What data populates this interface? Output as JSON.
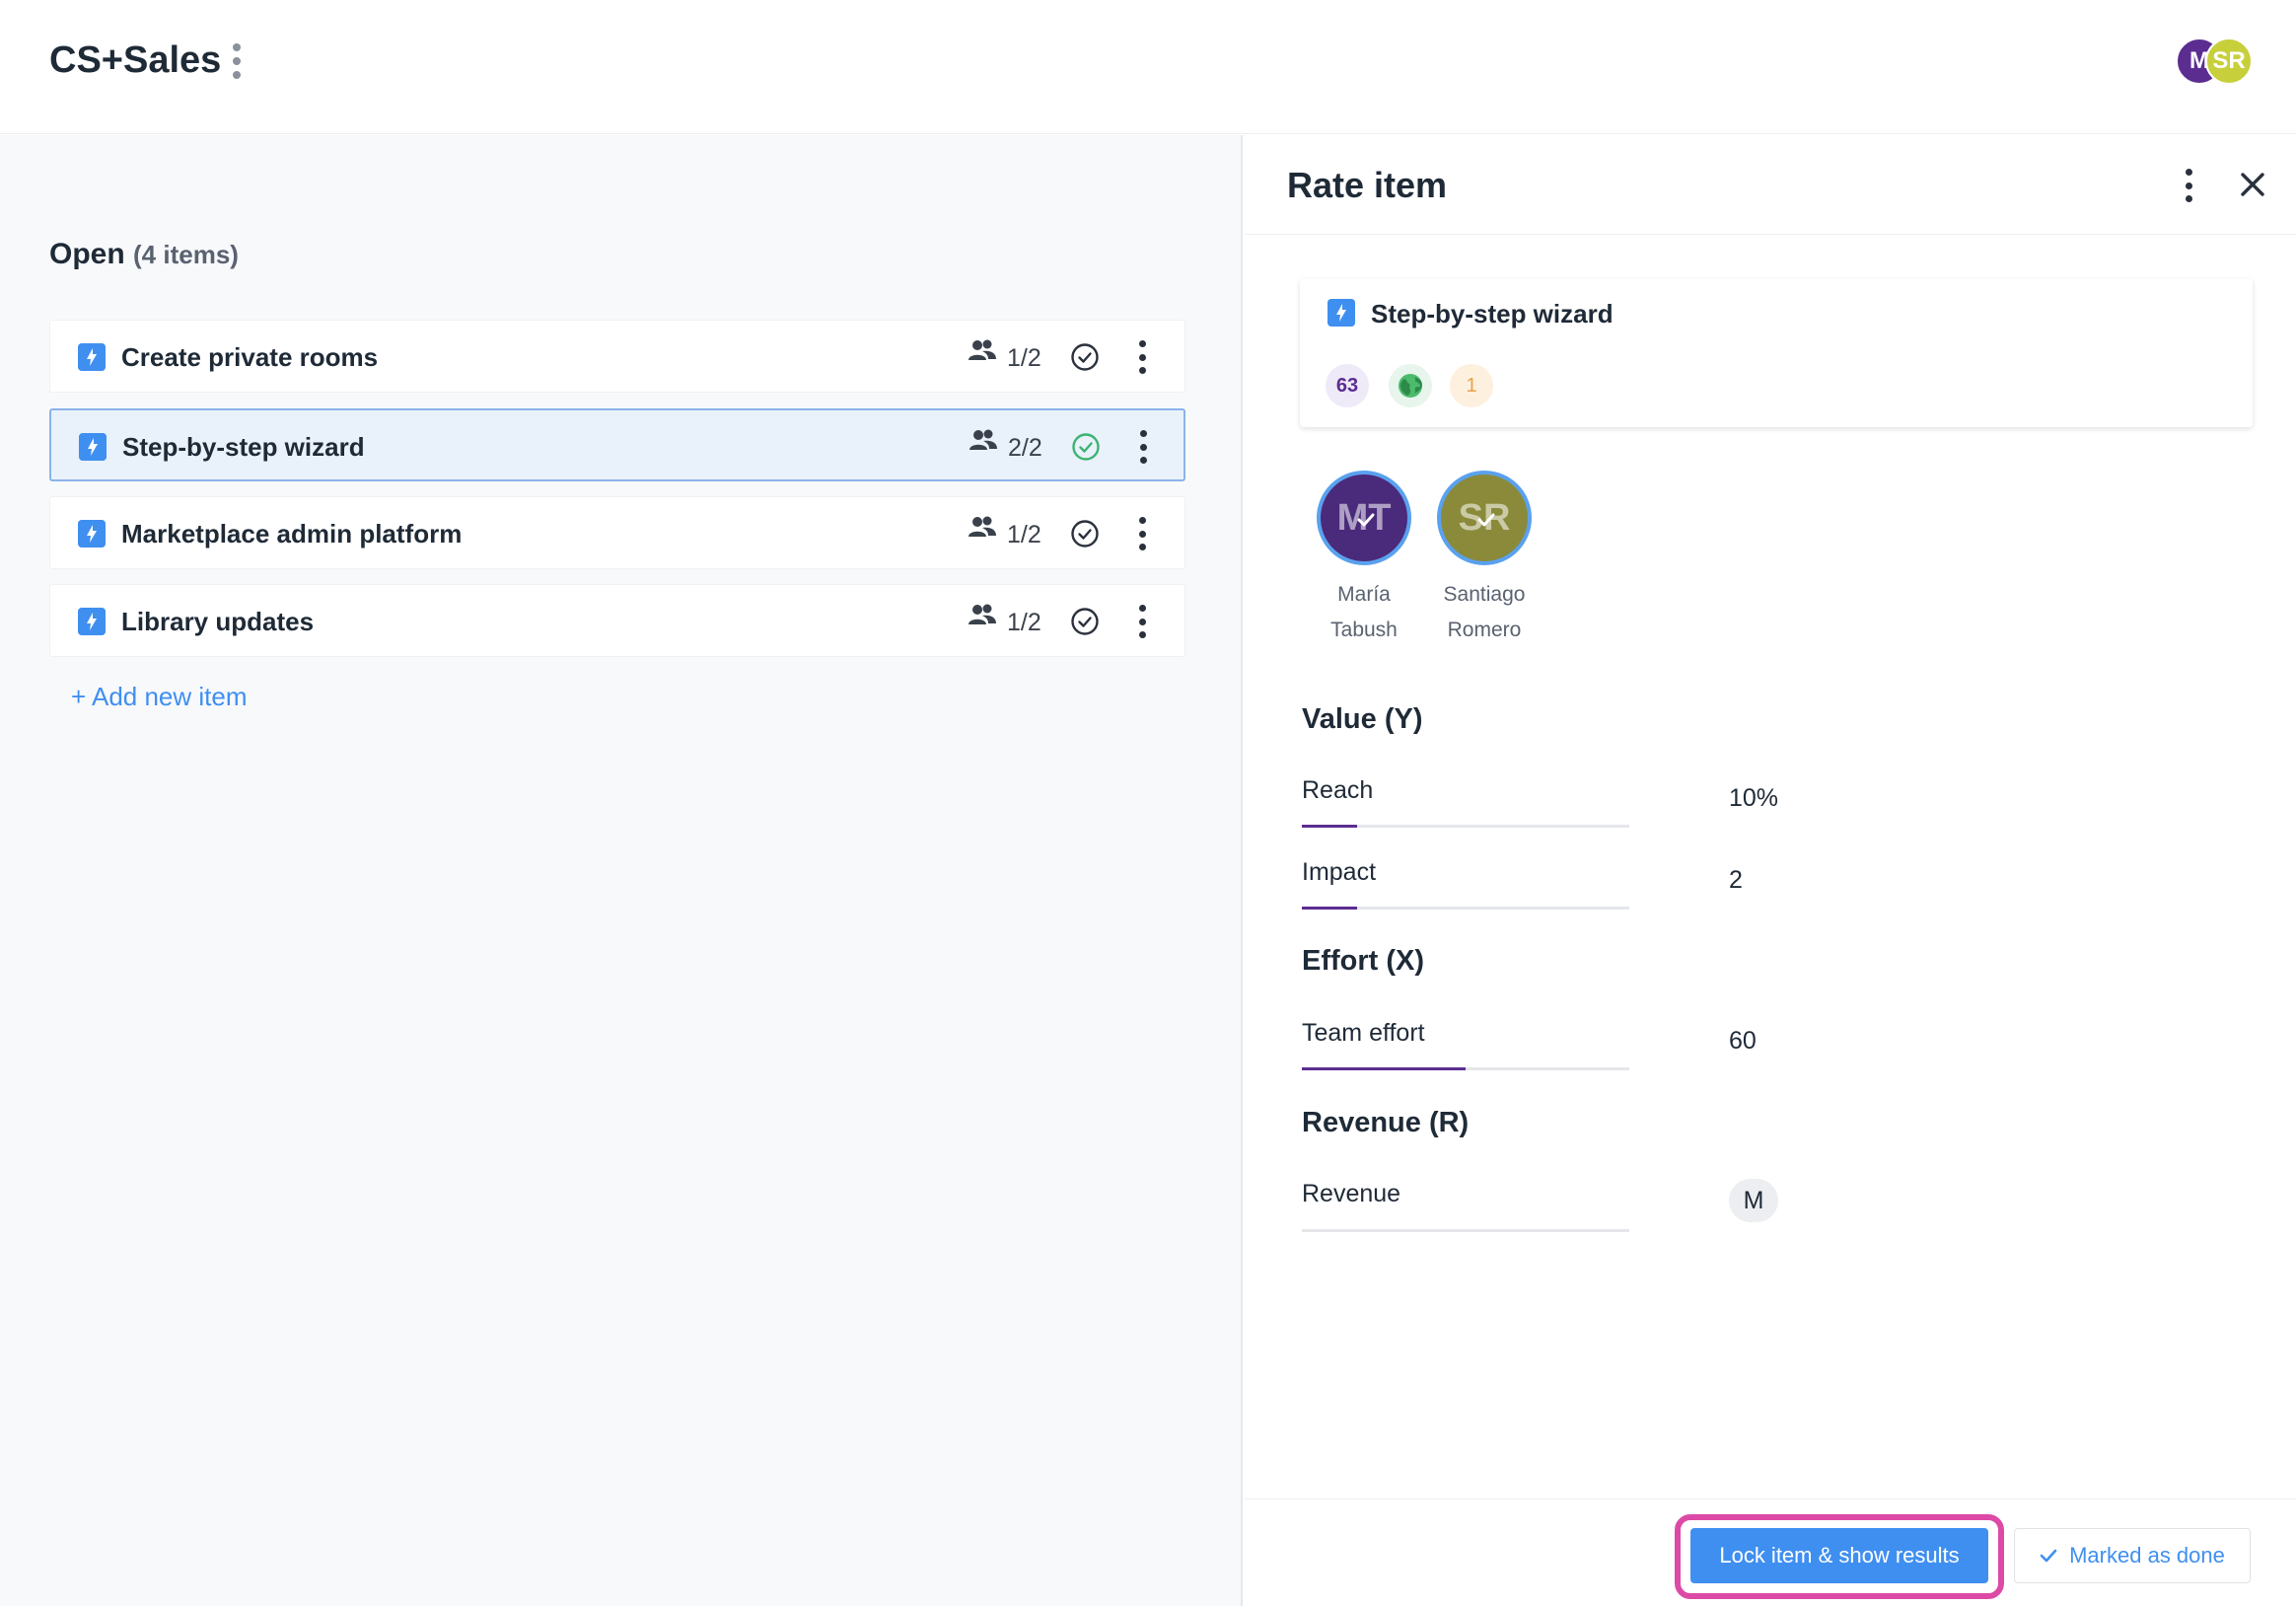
{
  "header": {
    "title": "CS+Sales",
    "avatars": [
      "M",
      "SR"
    ]
  },
  "list": {
    "section_title": "Open",
    "section_count": "(4 items)",
    "items": [
      {
        "title": "Create private rooms",
        "raters": "1/2",
        "selected": false
      },
      {
        "title": "Step-by-step wizard",
        "raters": "2/2",
        "selected": true
      },
      {
        "title": "Marketplace admin platform",
        "raters": "1/2",
        "selected": false
      },
      {
        "title": "Library updates",
        "raters": "1/2",
        "selected": false
      }
    ],
    "add_label": "+ Add new item"
  },
  "panel": {
    "title": "Rate item",
    "card": {
      "title": "Step-by-step wizard",
      "score": "63",
      "count": "1"
    },
    "raters": [
      {
        "initials": "MT",
        "first": "María",
        "last": "Tabush",
        "color": "#4a2a7a"
      },
      {
        "initials": "SR",
        "first": "Santiago",
        "last": "Romero",
        "color": "#8a8a3a"
      }
    ],
    "groups": {
      "value": "Value (Y)",
      "effort": "Effort (X)",
      "revenue": "Revenue (R)"
    },
    "fields": {
      "reach": {
        "label": "Reach",
        "value": "10%",
        "level": 0.17
      },
      "impact": {
        "label": "Impact",
        "value": "2",
        "level": 0.17
      },
      "team_effort": {
        "label": "Team effort",
        "value": "60",
        "level": 0.5
      },
      "revenue": {
        "label": "Revenue",
        "value": "M"
      }
    },
    "actions": {
      "lock_label": "Lock item & show results",
      "done_label": "Marked as done"
    }
  },
  "colors": {
    "accent": "#3f8ff0",
    "purple": "#5b2d91",
    "highlight": "#dd4aa6",
    "success": "#3cb371"
  }
}
